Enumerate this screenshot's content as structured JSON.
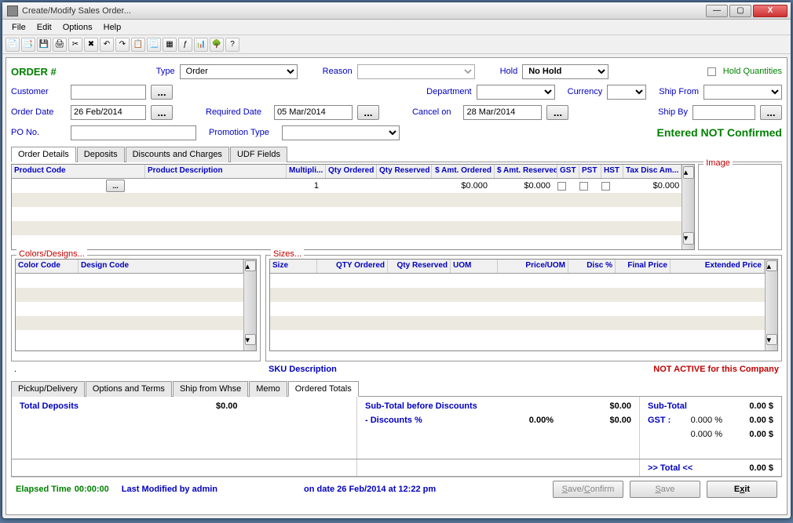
{
  "window": {
    "title": "Create/Modify Sales Order..."
  },
  "menu": [
    "File",
    "Edit",
    "Options",
    "Help"
  ],
  "header": {
    "order_label": "ORDER #",
    "type_label": "Type",
    "type_value": "Order",
    "reason_label": "Reason",
    "reason_value": "",
    "hold_label": "Hold",
    "hold_value": "No Hold",
    "hold_qty_label": "Hold Quantities",
    "customer_label": "Customer",
    "customer_value": "",
    "department_label": "Department",
    "department_value": "",
    "currency_label": "Currency",
    "currency_value": "",
    "shipfrom_label": "Ship From",
    "shipfrom_value": "",
    "orderdate_label": "Order Date",
    "orderdate_value": "26 Feb/2014",
    "reqdate_label": "Required Date",
    "reqdate_value": "05 Mar/2014",
    "cancel_label": "Cancel on",
    "cancel_value": "28 Mar/2014",
    "shipby_label": "Ship By",
    "shipby_value": "",
    "pono_label": "PO No.",
    "pono_value": "",
    "promo_label": "Promotion Type",
    "promo_value": "",
    "status": "Entered NOT Confirmed"
  },
  "tabs_main": [
    "Order Details",
    "Deposits",
    "Discounts and Charges",
    "UDF Fields"
  ],
  "grid_main": {
    "columns": [
      "Product Code",
      "Product Description",
      "Multipli...",
      "Qty Ordered",
      "Qty Reserved",
      "$ Amt. Ordered",
      "$ Amt. Reserved",
      "GST",
      "PST",
      "HST",
      "Tax Disc Am..."
    ],
    "row": {
      "multiplier": "1",
      "amt_ordered": "$0.000",
      "amt_reserved": "$0.000",
      "tax_disc": "$0.000"
    }
  },
  "image_label": "Image",
  "colors_box": {
    "legend": "Colors/Designs...",
    "columns": [
      "Color Code",
      "Design Code"
    ]
  },
  "sizes_box": {
    "legend": "Sizes...",
    "columns": [
      "Size",
      "QTY Ordered",
      "Qty Reserved",
      "UOM",
      "Price/UOM",
      "Disc %",
      "Final Price",
      "Extended Price"
    ],
    "sku_label": "SKU Description",
    "not_active": "NOT ACTIVE for this Company"
  },
  "dash_label": ".",
  "tabs_bottom": [
    "Pickup/Delivery",
    "Options and Terms",
    "Ship from Whse",
    "Memo",
    "Ordered Totals"
  ],
  "totals": {
    "total_deposits_label": "Total Deposits",
    "total_deposits_value": "$0.00",
    "subtotal_before_label": "Sub-Total before Discounts",
    "subtotal_before_value": "$0.00",
    "discounts_label": "- Discounts %",
    "discounts_pct": "0.00%",
    "discounts_value": "$0.00",
    "subtotal_label": "Sub-Total",
    "subtotal_value": "0.00 $",
    "gst_label": "GST :",
    "gst_pct": "0.000 %",
    "gst_value": "0.00 $",
    "blank_pct": "0.000 %",
    "blank_value": "0.00 $",
    "total_label": ">> Total <<",
    "total_value": "0.00 $"
  },
  "footer": {
    "elapsed_label": "Elapsed Time",
    "elapsed_value": "00:00:00",
    "modified": "Last Modified by admin",
    "ondate": "on date 26 Feb/2014 at 12:22 pm",
    "save_confirm": "Save/Confirm",
    "save": "Save",
    "exit": "Exit"
  }
}
